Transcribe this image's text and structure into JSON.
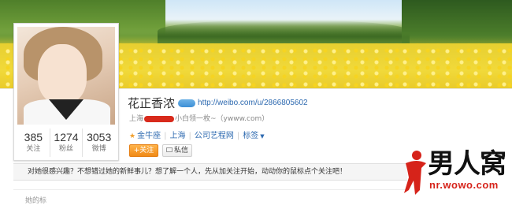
{
  "profile": {
    "name": "花正香浓",
    "blog_url": "http://weibo.com/u/2866805602",
    "location_prefix": "上海",
    "location_suffix": "小白领一枚~（ywww.com）",
    "stats": [
      {
        "value": "385",
        "label": "关注"
      },
      {
        "value": "1274",
        "label": "粉丝"
      },
      {
        "value": "3053",
        "label": "微博"
      }
    ],
    "tags": {
      "constellation": "金牛座",
      "city": "上海",
      "company": "公司艺程网",
      "tags_label": "标签"
    },
    "actions": {
      "follow_label": "+关注",
      "message_label": "私信"
    }
  },
  "prompt": "对她很感兴趣？不想错过她的新鲜事儿？想了解一个人，先从加关注开始，动动你的鼠标点个关注吧！",
  "lower_fragment": "她的标",
  "watermark": {
    "main": "男人窝",
    "sub": "nr.wowo.com"
  },
  "colors": {
    "link": "#2e6ab0",
    "follow_button": "#f08a16",
    "watermark_red": "#d6231a"
  },
  "icons": [
    "verified-badge-icon",
    "star-icon",
    "dropdown-caret-icon",
    "envelope-icon",
    "watermark-figure-icon"
  ]
}
